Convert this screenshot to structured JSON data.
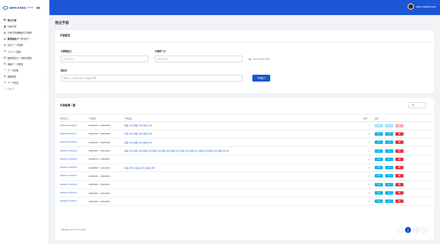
{
  "app": {
    "logo_main": "NIPS EYES",
    "logo_sub": "EXCEL"
  },
  "sidebar": {
    "items": [
      {
        "icon": "truck-icon",
        "glyph": "⛟",
        "label": "発注予測",
        "active": true
      },
      {
        "icon": "user-icon",
        "glyph": "👤",
        "label": "仕様予測",
        "active": false
      },
      {
        "icon": "grid-icon",
        "glyph": "▦",
        "label": "午後付売価格紐付け登録",
        "active": false
      },
      {
        "icon": "copy-icon",
        "glyph": "⧉",
        "label": "新規商品データコピー",
        "active": true
      },
      {
        "icon": "table-icon",
        "glyph": "▤",
        "label": "広告データ登録",
        "active": false
      },
      {
        "icon": "flag-icon",
        "glyph": "⚑",
        "label": "イベント登録",
        "active": false
      },
      {
        "icon": "grid-icon",
        "glyph": "▦",
        "label": "臨時発注日・休業日登録",
        "active": false
      },
      {
        "icon": "table-icon",
        "glyph": "▤",
        "label": "実績データ登録",
        "active": false
      },
      {
        "icon": "file-icon",
        "glyph": "▯",
        "label": "データ削除",
        "active": false
      },
      {
        "icon": "table-icon",
        "glyph": "▤",
        "label": "顧客設定",
        "active": false,
        "chevron": true
      },
      {
        "icon": "gear-icon",
        "glyph": "⚙",
        "label": "データ設定",
        "active": false,
        "chevron": true
      },
      {
        "icon": "help-icon",
        "glyph": "?",
        "label": "ヘルプ",
        "active": false,
        "chevron": true
      }
    ]
  },
  "topbar": {
    "username": "name_lb@test.com"
  },
  "page": {
    "title": "発注予測"
  },
  "settings_card": {
    "title": "予測設定",
    "start_label": "予測開始日",
    "start_value": "2023/04/24",
    "end_label": "予測終了日",
    "end_value": "2023/04/25",
    "checkbox_label": "Learn events mode",
    "product_label": "商品名",
    "product_placeholder": "選択なしの場合は全ての商品を予測",
    "run_button": "予測実行"
  },
  "results_card": {
    "title": "予測結果一覧",
    "per_page": "10",
    "columns": [
      "予測実行日",
      "予測期間",
      "予測商品",
      "操作",
      "状態"
    ],
    "rows": [
      {
        "run_date": "2023/01/23 15:55:25",
        "period": "2022/01/01 ～ 2022/06/30",
        "products": "商品_4001,商品_4002,商品_4003",
        "status": "processing"
      },
      {
        "run_date": "2023/01/23 16:15:37",
        "period": "2022/01/01 ～ 2022/06/30",
        "products": "商品_4001,商品_4002,商品_4003",
        "status": "done"
      },
      {
        "run_date": "2023/01/20 15:53:42",
        "period": "2022/01/01 ～ 2022/06/30",
        "products": "商品_4001,商品_4002,商品_4003",
        "status": "done"
      },
      {
        "run_date": "2023/01/17 16:23:49",
        "period": "2022/01/01 ～ 2022/10/31",
        "products": "商品_4001,商品_4002,商品_4003,商品_3011,商品_3002,商品_3031,商品_3012,商品_3017,商品_4015,商品_3001,商品_4004,商...",
        "status": "done"
      },
      {
        "run_date": "2023/01/17 16:59:03",
        "period": "2022/03/16 ～ 2022/06/17",
        "products": "",
        "status": "done"
      },
      {
        "run_date": "2023/01/17 16:35:49",
        "period": "2022/08/01 ～ 2022/12/31",
        "products": "商品_4001,1,商品_4001,1,商品_4001",
        "status": "done"
      },
      {
        "run_date": "2023/01/17 16:03:57",
        "period": "2022/01/01 ～ 2022/06/31",
        "products": "",
        "status": "done"
      },
      {
        "run_date": "2023/01/17 15:49:42",
        "period": "2022/04/01 ～ 2022/12/31",
        "products": "",
        "status": "done"
      },
      {
        "run_date": "2023/01/17 15:48:19",
        "period": "2022/04/01 ～ 2022/12/31",
        "products": "",
        "status": "done"
      },
      {
        "run_date": "2023/01/17 12:56:14",
        "period": "2022/12/01 ～ 2022/12/31",
        "products": "",
        "status": "done"
      }
    ],
    "action_labels": {
      "csv": "csv",
      "download": "☁",
      "delete": "🗑"
    },
    "footer": "Showing 1 to 10 of 13 entries",
    "pager": {
      "prev": "‹",
      "pages": [
        "1",
        "2"
      ],
      "next": "›",
      "current": "1"
    }
  },
  "colors": {
    "primary": "#1b56d4",
    "cyan": "#17b7e6",
    "red": "#e03b4a",
    "ok": "#2fa85a"
  }
}
